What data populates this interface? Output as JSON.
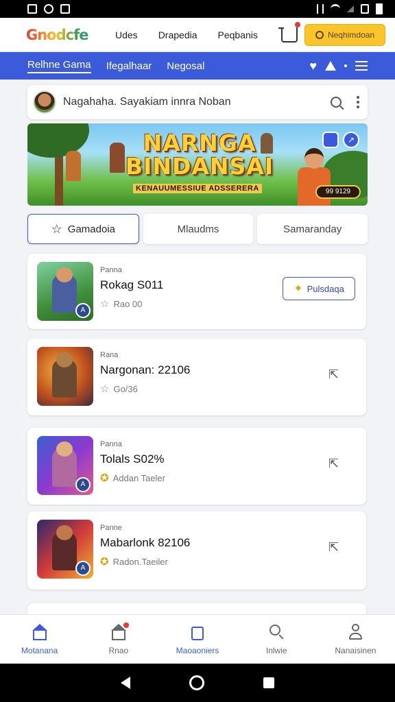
{
  "header": {
    "logo": "Gnodcfe",
    "links": [
      "Udes",
      "Drapedia",
      "Peqbanis"
    ],
    "signin_label": "Neqhimdoan"
  },
  "nav": {
    "links": [
      "Relhne Gama",
      "Ifegalhaar",
      "Negosal"
    ]
  },
  "search": {
    "text": "Nagahaha.  Sayakiam innra Noban"
  },
  "banner": {
    "title_line1": "NARNGA",
    "title_line2": "BINDANSAI",
    "subtitle": "KENAUUMESSIUE ADSSERERA",
    "counter": "99 9129"
  },
  "tabs": [
    "Gamadoia",
    "Mlaudms",
    "Samaranday"
  ],
  "games": [
    {
      "category": "Panna",
      "title": "Rokag S011",
      "meta": "Rao 00",
      "star": "gray",
      "action": "Pulsdaqa"
    },
    {
      "category": "Rana",
      "title": "Nargonan: 22106",
      "meta": "Go/36",
      "star": "gray",
      "action": ""
    },
    {
      "category": "Panna",
      "title": "Tolals S02%",
      "meta": "Addan Taeler",
      "star": "gold",
      "action": ""
    },
    {
      "category": "Panne",
      "title": "Mabarlonk 82106",
      "meta": "Radon.Taeiler",
      "star": "gold",
      "action": ""
    }
  ],
  "bottom_nav": [
    {
      "label": "Motanana",
      "icon": "home-icon",
      "active": true
    },
    {
      "label": "Rnao",
      "icon": "store-icon",
      "active": false
    },
    {
      "label": "Maoaoniers",
      "icon": "bag-icon",
      "active": true
    },
    {
      "label": "Inlwie",
      "icon": "search-icon",
      "active": false
    },
    {
      "label": "Nanaisinen",
      "icon": "profile-icon",
      "active": false
    }
  ],
  "colors": {
    "primary": "#3b5bdb",
    "accent": "#f9c52b",
    "background": "#f2f3f6"
  }
}
